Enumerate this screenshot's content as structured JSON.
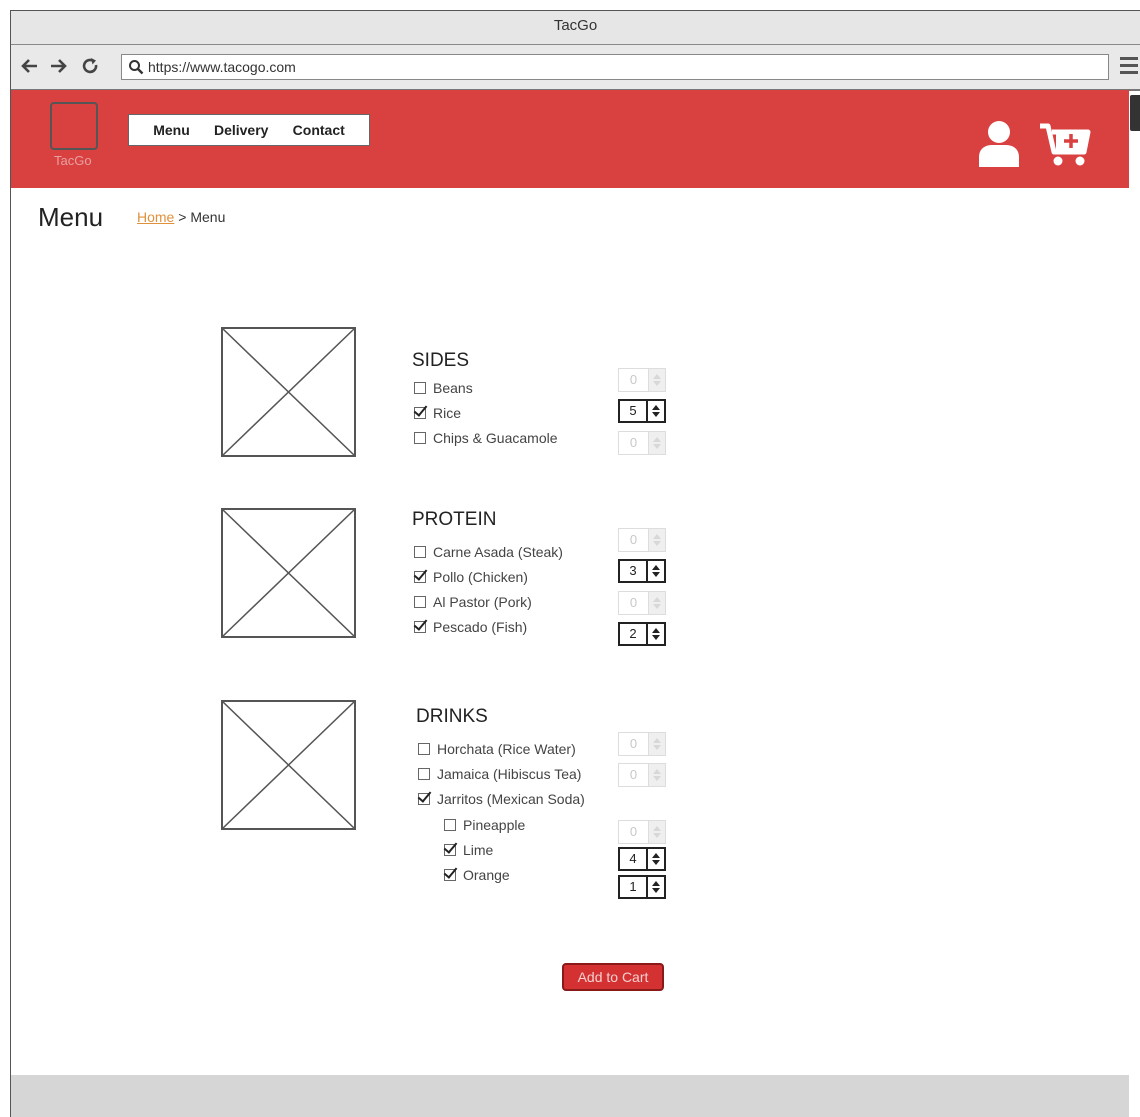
{
  "window": {
    "title": "TacGo"
  },
  "browser": {
    "url": "https://www.tacogo.com"
  },
  "header": {
    "logo_text": "TacGo",
    "nav": [
      {
        "label": "Menu"
      },
      {
        "label": "Delivery"
      },
      {
        "label": "Contact"
      }
    ]
  },
  "page": {
    "title": "Menu",
    "breadcrumb": {
      "home": "Home",
      "separator": ">",
      "current": "Menu"
    }
  },
  "sections": [
    {
      "title": "SIDES",
      "items": [
        {
          "label": "Beans",
          "checked": false,
          "qty": "0"
        },
        {
          "label": "Rice",
          "checked": true,
          "qty": "5"
        },
        {
          "label": "Chips & Guacamole",
          "checked": false,
          "qty": "0"
        }
      ]
    },
    {
      "title": "PROTEIN",
      "items": [
        {
          "label": "Carne Asada (Steak)",
          "checked": false,
          "qty": "0"
        },
        {
          "label": "Pollo (Chicken)",
          "checked": true,
          "qty": "3"
        },
        {
          "label": "Al Pastor (Pork)",
          "checked": false,
          "qty": "0"
        },
        {
          "label": "Pescado (Fish)",
          "checked": true,
          "qty": "2"
        }
      ]
    },
    {
      "title": "DRINKS",
      "items": [
        {
          "label": "Horchata (Rice Water)",
          "checked": false,
          "qty": "0"
        },
        {
          "label": "Jamaica (Hibiscus Tea)",
          "checked": false,
          "qty": "0"
        },
        {
          "label": "Jarritos (Mexican Soda)",
          "checked": true
        },
        {
          "label": "Pineapple",
          "checked": false,
          "qty": "0"
        },
        {
          "label": "Lime",
          "checked": true,
          "qty": "4"
        },
        {
          "label": "Orange",
          "checked": true,
          "qty": "1"
        }
      ]
    }
  ],
  "actions": {
    "add_to_cart": "Add to Cart"
  },
  "colors": {
    "header_bg": "#d94040",
    "button_bg": "#d43232",
    "link": "#e0913c"
  },
  "icons": [
    "back-arrow-icon",
    "forward-arrow-icon",
    "refresh-icon",
    "search-icon",
    "menu-icon",
    "user-icon",
    "cart-icon"
  ]
}
